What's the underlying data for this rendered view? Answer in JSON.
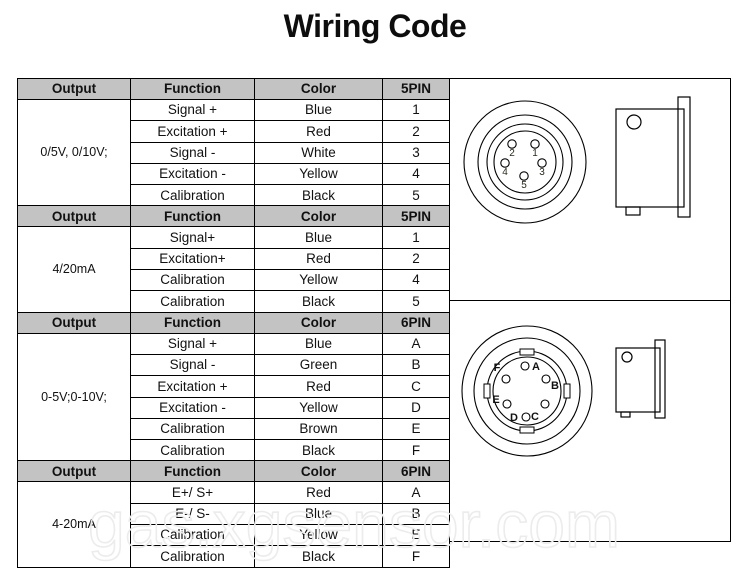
{
  "page": {
    "title": "Wiring Code",
    "watermark": "gas.xgsensor.com"
  },
  "table": {
    "columns": [
      "Output",
      "Function",
      "Color",
      "5PIN"
    ],
    "sections": [
      {
        "headers": [
          "Output",
          "Function",
          "Color",
          "5PIN"
        ],
        "output": "0/5V, 0/10V;",
        "rows": [
          {
            "function": "Signal +",
            "color": "Blue",
            "pin": "1"
          },
          {
            "function": "Excitation +",
            "color": "Red",
            "pin": "2"
          },
          {
            "function": "Signal -",
            "color": "White",
            "pin": "3"
          },
          {
            "function": "Excitation -",
            "color": "Yellow",
            "pin": "4"
          },
          {
            "function": "Calibration",
            "color": "Black",
            "pin": "5"
          }
        ]
      },
      {
        "headers": [
          "Output",
          "Function",
          "Color",
          "5PIN"
        ],
        "output": "4/20mA",
        "rows": [
          {
            "function": "Signal+",
            "color": "Blue",
            "pin": "1"
          },
          {
            "function": "Excitation+",
            "color": "Red",
            "pin": "2"
          },
          {
            "function": "Calibration",
            "color": "Yellow",
            "pin": "4"
          },
          {
            "function": "Calibration",
            "color": "Black",
            "pin": "5"
          }
        ]
      },
      {
        "headers": [
          "Output",
          "Function",
          "Color",
          "6PIN"
        ],
        "output": "0-5V;0-10V;",
        "rows": [
          {
            "function": "Signal +",
            "color": "Blue",
            "pin": "A"
          },
          {
            "function": "Signal -",
            "color": "Green",
            "pin": "B"
          },
          {
            "function": "Excitation +",
            "color": "Red",
            "pin": "C"
          },
          {
            "function": "Excitation -",
            "color": "Yellow",
            "pin": "D"
          },
          {
            "function": "Calibration",
            "color": "Brown",
            "pin": "E"
          },
          {
            "function": "Calibration",
            "color": "Black",
            "pin": "F"
          }
        ]
      },
      {
        "headers": [
          "Output",
          "Function",
          "Color",
          "6PIN"
        ],
        "output": "4-20mA",
        "rows": [
          {
            "function": "E+/ S+",
            "color": "Red",
            "pin": "A"
          },
          {
            "function": "E-/ S-",
            "color": "Blue",
            "pin": "B"
          },
          {
            "function": "Calibration",
            "color": "Yellow",
            "pin": "E"
          },
          {
            "function": "Calibration",
            "color": "Black",
            "pin": "F"
          }
        ]
      }
    ]
  },
  "diagrams": {
    "five_pin": {
      "label": "5PIN connector",
      "pins": [
        "2",
        "1",
        "4",
        "3",
        "5"
      ]
    },
    "six_pin": {
      "label": "6PIN connector",
      "pins": [
        "A",
        "B",
        "C",
        "D",
        "E",
        "F"
      ]
    }
  }
}
